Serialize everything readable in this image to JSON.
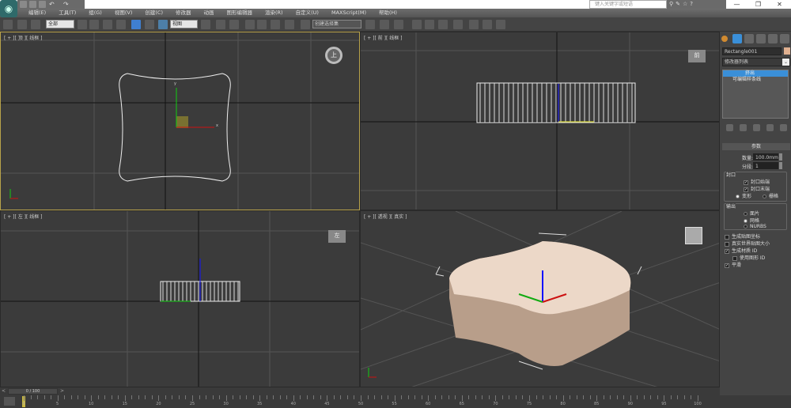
{
  "app": {
    "quick_access": [
      "new",
      "open",
      "save",
      "undo",
      "redo"
    ]
  },
  "search": {
    "placeholder": "键入关键字或短语"
  },
  "window": {
    "minimize": "—",
    "restore": "❐",
    "close": "✕"
  },
  "menu": [
    "编辑(E)",
    "工具(T)",
    "组(G)",
    "视图(V)",
    "创建(C)",
    "修改器",
    "动画",
    "图形编辑器",
    "渲染(R)",
    "自定义(U)",
    "MAXScript(M)",
    "帮助(H)"
  ],
  "toolbar": {
    "selection_filter": "全部",
    "ref_coord": "视图",
    "named_selection": "创建选择集"
  },
  "viewports": [
    {
      "label": "[ + ][ 顶 ][ 线框 ]",
      "cube": "上"
    },
    {
      "label": "[ + ][ 前 ][ 线框 ]",
      "cube": "前"
    },
    {
      "label": "[ + ][ 左 ][ 线框 ]",
      "cube": "左"
    },
    {
      "label": "[ + ][ 透视 ][ 真实 ]",
      "cube": ""
    }
  ],
  "panel": {
    "object_name": "Rectangle001",
    "object_color": "#e0b090",
    "modifier_list": "修改器列表",
    "stack": [
      "挤出",
      "可编辑样条线"
    ],
    "rollout_title": "参数",
    "amount_label": "数量:",
    "amount_value": "100.0mm",
    "segments_label": "分段:",
    "segments_value": "1",
    "capping_title": "封口",
    "cap_start": "封口始端",
    "cap_end": "封口末端",
    "morph": "变形",
    "grid": "栅格",
    "output_title": "输出",
    "output_options": [
      "面片",
      "网格",
      "NURBS"
    ],
    "gen_mapping": "生成贴图坐标",
    "real_world": "真实世界贴图大小",
    "gen_mat_ids": "生成材质 ID",
    "use_shape_ids": "使用图形 ID",
    "smooth": "平滑"
  },
  "timeline": {
    "frame": "0 / 100",
    "prev": "<",
    "next": ">",
    "labels": [
      "0",
      "5",
      "10",
      "15",
      "20",
      "25",
      "30",
      "35",
      "40",
      "45",
      "50",
      "55",
      "60",
      "65",
      "70",
      "75",
      "80",
      "85",
      "90",
      "95",
      "100"
    ]
  }
}
